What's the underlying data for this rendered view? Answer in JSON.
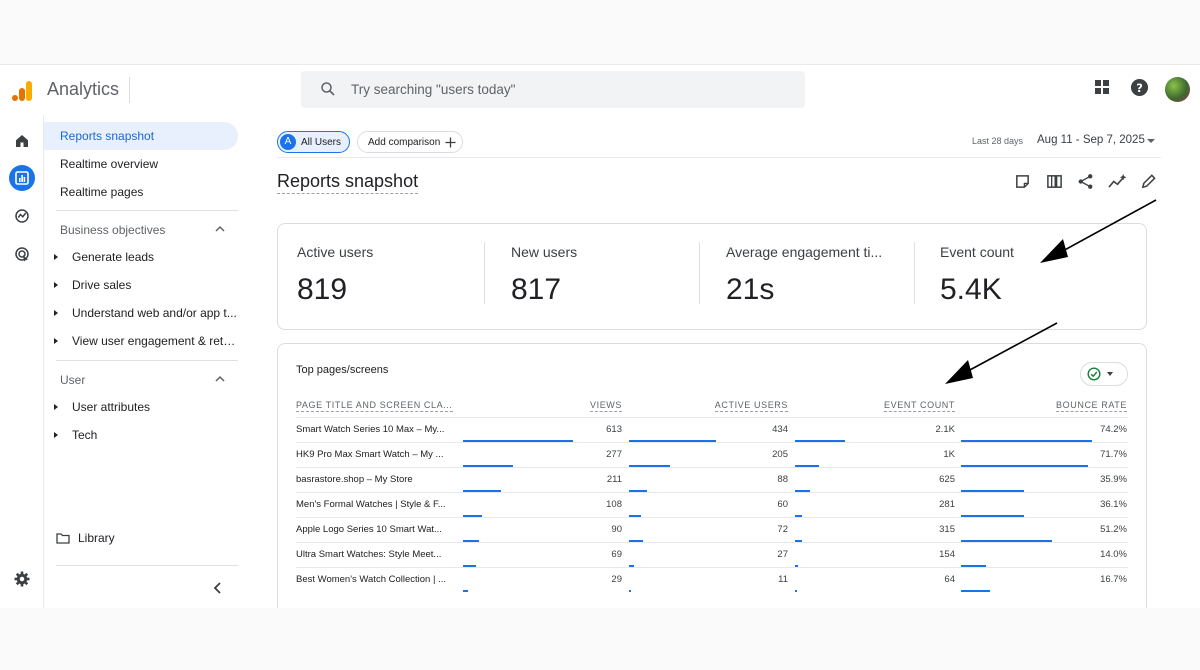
{
  "header": {
    "brand": "Analytics",
    "search_placeholder": "Try searching \"users today\""
  },
  "nav": {
    "top_items": [
      "Reports snapshot",
      "Realtime overview",
      "Realtime pages"
    ],
    "sections": [
      {
        "title": "Business objectives",
        "items": [
          "Generate leads",
          "Drive sales",
          "Understand web and/or app t...",
          "View user engagement & rete..."
        ]
      },
      {
        "title": "User",
        "items": [
          "User attributes",
          "Tech"
        ]
      }
    ],
    "library": "Library"
  },
  "toolbar": {
    "segment_badge": "A",
    "segment_label": "All Users",
    "add_comparison": "Add comparison",
    "date_label": "Last 28 days",
    "date_range": "Aug 11 - Sep 7, 2025"
  },
  "page": {
    "title": "Reports snapshot"
  },
  "metrics": [
    {
      "label": "Active users",
      "value": "819"
    },
    {
      "label": "New users",
      "value": "817"
    },
    {
      "label": "Average engagement ti...",
      "value": "21s"
    },
    {
      "label": "Event count",
      "value": "5.4K"
    }
  ],
  "table": {
    "title": "Top pages/screens",
    "headers": [
      "PAGE TITLE AND SCREEN CLA...",
      "VIEWS",
      "ACTIVE USERS",
      "EVENT COUNT",
      "BOUNCE RATE"
    ],
    "rows": [
      {
        "name": "Smart Watch Series 10 Max – My...",
        "views": "613",
        "active": "434",
        "events": "2.1K",
        "bounce": "74.2%",
        "bars": [
          0.69,
          0.97,
          0.74,
          0.95
        ]
      },
      {
        "name": "HK9 Pro Max Smart Watch – My ...",
        "views": "277",
        "active": "205",
        "events": "1K",
        "bounce": "71.7%",
        "bars": [
          0.31,
          0.46,
          0.35,
          0.92
        ]
      },
      {
        "name": "basrastore.shop – My Store",
        "views": "211",
        "active": "88",
        "events": "625",
        "bounce": "35.9%",
        "bars": [
          0.24,
          0.2,
          0.22,
          0.46
        ]
      },
      {
        "name": "Men's Formal Watches | Style & F...",
        "views": "108",
        "active": "60",
        "events": "281",
        "bounce": "36.1%",
        "bars": [
          0.12,
          0.13,
          0.1,
          0.46
        ]
      },
      {
        "name": "Apple Logo Series 10 Smart Wat...",
        "views": "90",
        "active": "72",
        "events": "315",
        "bounce": "51.2%",
        "bars": [
          0.1,
          0.16,
          0.11,
          0.66
        ]
      },
      {
        "name": "Ultra Smart Watches: Style Meet...",
        "views": "69",
        "active": "27",
        "events": "154",
        "bounce": "14.0%",
        "bars": [
          0.08,
          0.06,
          0.05,
          0.18
        ]
      },
      {
        "name": "Best Women's Watch Collection | ...",
        "views": "29",
        "active": "11",
        "events": "64",
        "bounce": "16.7%",
        "bars": [
          0.03,
          0.02,
          0.02,
          0.21
        ]
      }
    ]
  },
  "colors": {
    "accent": "#1a73e8",
    "logo_orange": "#f9ab00",
    "logo_dark": "#e37400"
  }
}
